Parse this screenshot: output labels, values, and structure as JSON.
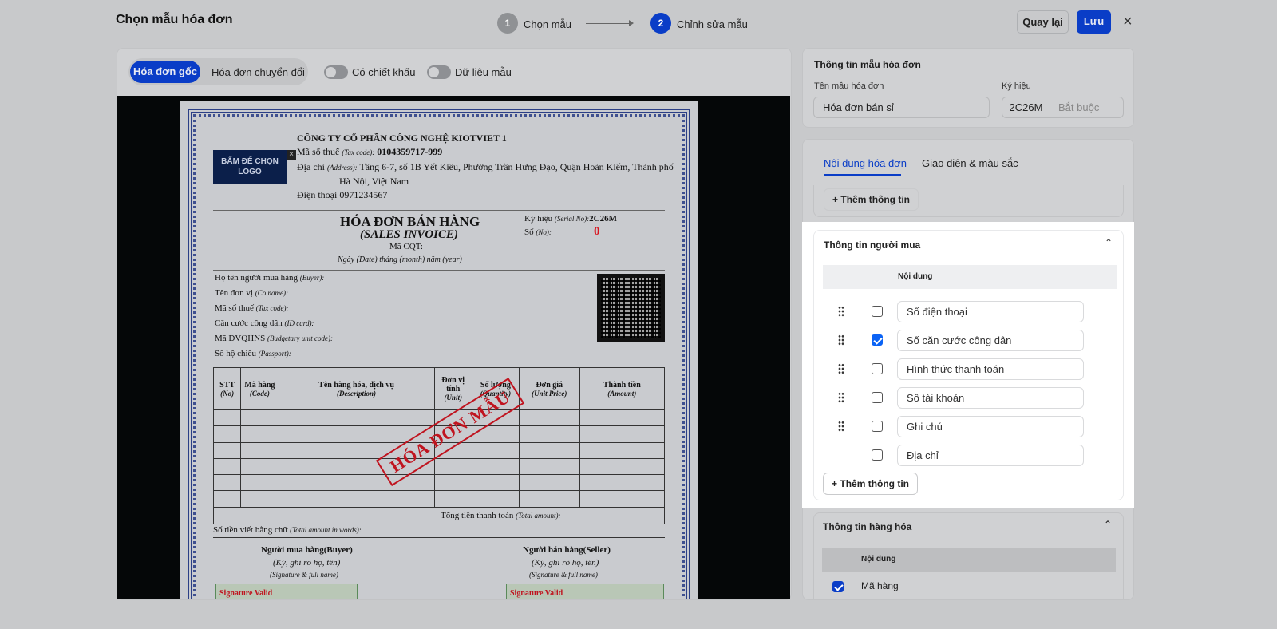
{
  "header": {
    "title": "Chọn mẫu hóa đơn",
    "steps": [
      {
        "num": "1",
        "label": "Chọn mẫu"
      },
      {
        "num": "2",
        "label": "Chỉnh sửa mẫu"
      }
    ],
    "back_label": "Quay lại",
    "save_label": "Lưu",
    "close_icon": "×"
  },
  "toolbar": {
    "segments": [
      "Hóa đơn gốc",
      "Hóa đơn chuyển đổi"
    ],
    "toggle_discount": "Có chiết khấu",
    "toggle_sample": "Dữ liệu mẫu"
  },
  "invoice": {
    "logo_text": "BẤM ĐỂ CHỌN LOGO",
    "logo_close": "×",
    "company": "CÔNG TY CỔ PHẦN CÔNG NGHỆ KIOTVIET 1",
    "tax_label": "Mã số thuế",
    "tax_en": "(Tax code):",
    "tax_value": "0104359717-999",
    "addr_label": "Địa chỉ",
    "addr_en": "(Address):",
    "addr_value": "Tầng 6-7, số 1B Yết Kiêu, Phường Trần Hưng Đạo, Quận Hoàn Kiếm, Thành phố",
    "addr_value2": "Hà Nội, Việt Nam",
    "phone": "Điện thoại 0971234567",
    "title": "HÓA ĐƠN BÁN HÀNG",
    "title_en": "(SALES INVOICE)",
    "cqt": "Mã CQT:",
    "date_line": "Ngày (Date)  tháng (month)  năm (year)",
    "serial_label": "Ký hiệu",
    "serial_en": "(Serial No):",
    "serial_value": "2C26M",
    "no_label": "Số",
    "no_en": "(No):",
    "no_value": "0",
    "buyer_fields": [
      {
        "vi": "Họ tên người mua hàng",
        "en": "(Buyer):"
      },
      {
        "vi": "Tên đơn vị",
        "en": "(Co.name):"
      },
      {
        "vi": "Mã số thuế",
        "en": "(Tax code):"
      },
      {
        "vi": "Căn cước công dân",
        "en": "(ID card):"
      },
      {
        "vi": "Mã ĐVQHNS",
        "en": "(Budgetary unit code):"
      },
      {
        "vi": "Số hộ chiếu",
        "en": "(Passport):"
      }
    ],
    "columns": [
      {
        "vi": "STT",
        "en": "(No)"
      },
      {
        "vi": "Mã hàng",
        "en": "(Code)"
      },
      {
        "vi": "Tên hàng hóa, dịch vụ",
        "en": "(Description)"
      },
      {
        "vi": "Đơn vị tính",
        "en": "(Unit)"
      },
      {
        "vi": "Số lượng",
        "en": "(Quantity)"
      },
      {
        "vi": "Đơn giá",
        "en": "(Unit Price)"
      },
      {
        "vi": "Thành tiền",
        "en": "(Amount)"
      }
    ],
    "total_label": "Tổng tiền thanh toán",
    "total_en": "(Total amount):",
    "words_label": "Số tiền viết bằng chữ",
    "words_en": "(Total amount in words):",
    "buyer_sig": "Người mua hàng(Buyer)",
    "seller_sig": "Người bán hàng(Seller)",
    "sig_hint": "(Ký, ghi rõ họ, tên)",
    "sig_hint_en": "(Signature & full name)",
    "sig_valid": "Signature Valid",
    "stamp": "HÓA ĐƠN MẪU"
  },
  "template_info": {
    "heading": "Thông tin mẫu hóa đơn",
    "name_label": "Tên mẫu hóa đơn",
    "name_value": "Hóa đơn bán sỉ",
    "symbol_label": "Ký hiệu",
    "symbol_prefix": "2C26M",
    "symbol_placeholder": "Bắt buộc"
  },
  "tabs": [
    "Nội dung hóa đơn",
    "Giao diện & màu sắc"
  ],
  "add_info_label": "Thêm thông tin",
  "buyer_section": {
    "title": "Thông tin người mua",
    "col_header": "Nội dung",
    "rows": [
      {
        "label": "Số điện thoại",
        "checked": false,
        "draggable": true
      },
      {
        "label": "Số căn cước công dân",
        "checked": true,
        "draggable": true
      },
      {
        "label": "Hình thức thanh toán",
        "checked": false,
        "draggable": true
      },
      {
        "label": "Số tài khoản",
        "checked": false,
        "draggable": true
      },
      {
        "label": "Ghi chú",
        "checked": false,
        "draggable": true
      },
      {
        "label": "Địa chỉ",
        "checked": false,
        "draggable": false
      }
    ]
  },
  "goods_section": {
    "title": "Thông tin hàng hóa",
    "col_header": "Nội dung",
    "rows": [
      {
        "label": "Mã hàng",
        "checked": true
      }
    ]
  },
  "colors": {
    "primary": "#0a3dc7",
    "overlay": "#c8c9cb",
    "stamp": "#c0141f"
  }
}
